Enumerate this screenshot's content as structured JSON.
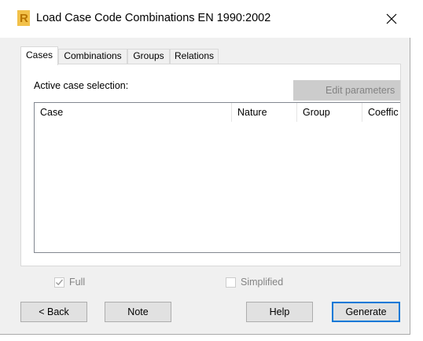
{
  "window": {
    "title": "Load Case Code Combinations EN 1990:2002",
    "app_icon": "revit-R-icon",
    "close_icon": "close-icon"
  },
  "tabs": [
    {
      "label": "Cases",
      "active": true
    },
    {
      "label": "Combinations",
      "active": false
    },
    {
      "label": "Groups",
      "active": false
    },
    {
      "label": "Relations",
      "active": false
    }
  ],
  "cases_panel": {
    "active_case_label": "Active case selection:",
    "edit_parameters_label": "Edit parameters",
    "columns": [
      "Case",
      "Nature",
      "Group",
      "Coeffic"
    ],
    "rows": []
  },
  "options": {
    "full_label": "Full",
    "full_checked": true,
    "simplified_label": "Simplified",
    "simplified_checked": false
  },
  "buttons": {
    "back": "< Back",
    "note": "Note",
    "help": "Help",
    "generate": "Generate"
  },
  "colors": {
    "icon_accent": "#e8a317",
    "default_button_border": "#0078d7",
    "disabled_text": "#838383"
  }
}
